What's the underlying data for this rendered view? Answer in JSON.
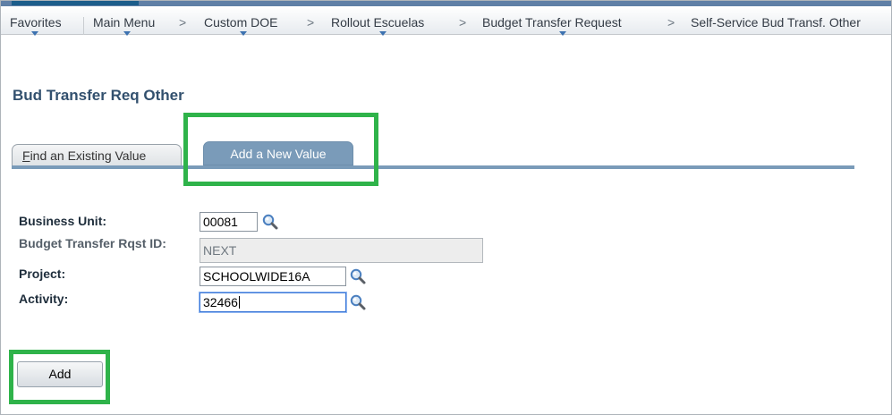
{
  "breadcrumb": {
    "items": [
      {
        "label": "Favorites"
      },
      {
        "label": "Main Menu"
      },
      {
        "label": "Custom DOE"
      },
      {
        "label": "Rollout Escuelas"
      },
      {
        "label": "Budget Transfer Request"
      },
      {
        "label": "Self-Service Bud Transf. Other"
      }
    ],
    "separator": ">"
  },
  "page": {
    "title": "Bud Transfer Req Other"
  },
  "tabs": {
    "find": {
      "label_hotkey": "F",
      "label_rest": "ind an Existing Value"
    },
    "add": {
      "label": "Add a New Value"
    }
  },
  "form": {
    "business_unit": {
      "label": "Business Unit:",
      "value": "00081"
    },
    "request_id": {
      "label": "Budget Transfer Rqst ID:",
      "value": "NEXT"
    },
    "project": {
      "label": "Project:",
      "value": "SCHOOLWIDE16A"
    },
    "activity": {
      "label": "Activity:",
      "value": "32466"
    }
  },
  "actions": {
    "add_label": "Add"
  },
  "colors": {
    "highlight": "#2fb34a",
    "tab_active": "#7a9bb9",
    "title": "#32506e"
  },
  "icons": {
    "lookup": "magnifier-icon",
    "menu_caret": "chevron-down-icon"
  }
}
